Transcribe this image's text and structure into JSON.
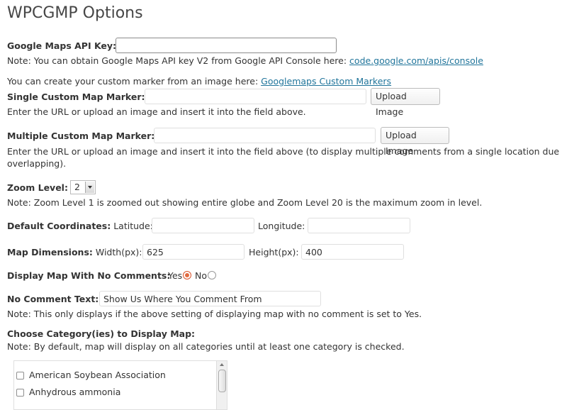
{
  "title": "WPCGMP Options",
  "api_key": {
    "label": "Google Maps API Key:",
    "value": "",
    "note": "Note: You can obtain Google Maps API key V2 from Google API Console here: ",
    "link": "code.google.com/apis/console"
  },
  "custom_marker": {
    "intro": "You can create your custom marker from an image here: ",
    "link": "Googlemaps Custom Markers"
  },
  "single_marker": {
    "label": "Single Custom Map Marker:",
    "value": "",
    "button": "Upload Image",
    "note": "Enter the URL or upload an image and insert it into the field above."
  },
  "multiple_marker": {
    "label": "Multiple Custom Map Marker:",
    "value": "",
    "button": "Upload Image",
    "note_line1": "Enter the URL or upload an image and insert it into the field above (to display multiple comments from a single location due to",
    "note_line2": "overlapping)."
  },
  "zoom": {
    "label": "Zoom Level:",
    "value": "2",
    "note": "Note: Zoom Level 1 is zoomed out showing entire globe and Zoom Level 20 is the maximum zoom in level."
  },
  "coordinates": {
    "label": "Default Coordinates:",
    "latitude_label": "Latitude:",
    "latitude_value": "",
    "longitude_label": "Longitude:",
    "longitude_value": ""
  },
  "dimensions": {
    "label": "Map Dimensions:",
    "width_label": "Width(px):",
    "width_value": "625",
    "height_label": "Height(px):",
    "height_value": "400"
  },
  "no_comments": {
    "label": "Display Map With No Comments:",
    "yes": "Yes",
    "no": "No",
    "selected": "Yes"
  },
  "no_comment_text": {
    "label": "No Comment Text:",
    "value": "Show Us Where You Comment From",
    "note": "Note: This only displays if the above setting of displaying map with no comment is set to Yes."
  },
  "categories": {
    "label": "Choose Category(ies) to Display Map:",
    "note": "Note: By default, map will display on all categories until at least one category is checked.",
    "items": [
      {
        "label": "American Soybean Association",
        "checked": false
      },
      {
        "label": "Anhydrous ammonia",
        "checked": false
      }
    ]
  }
}
